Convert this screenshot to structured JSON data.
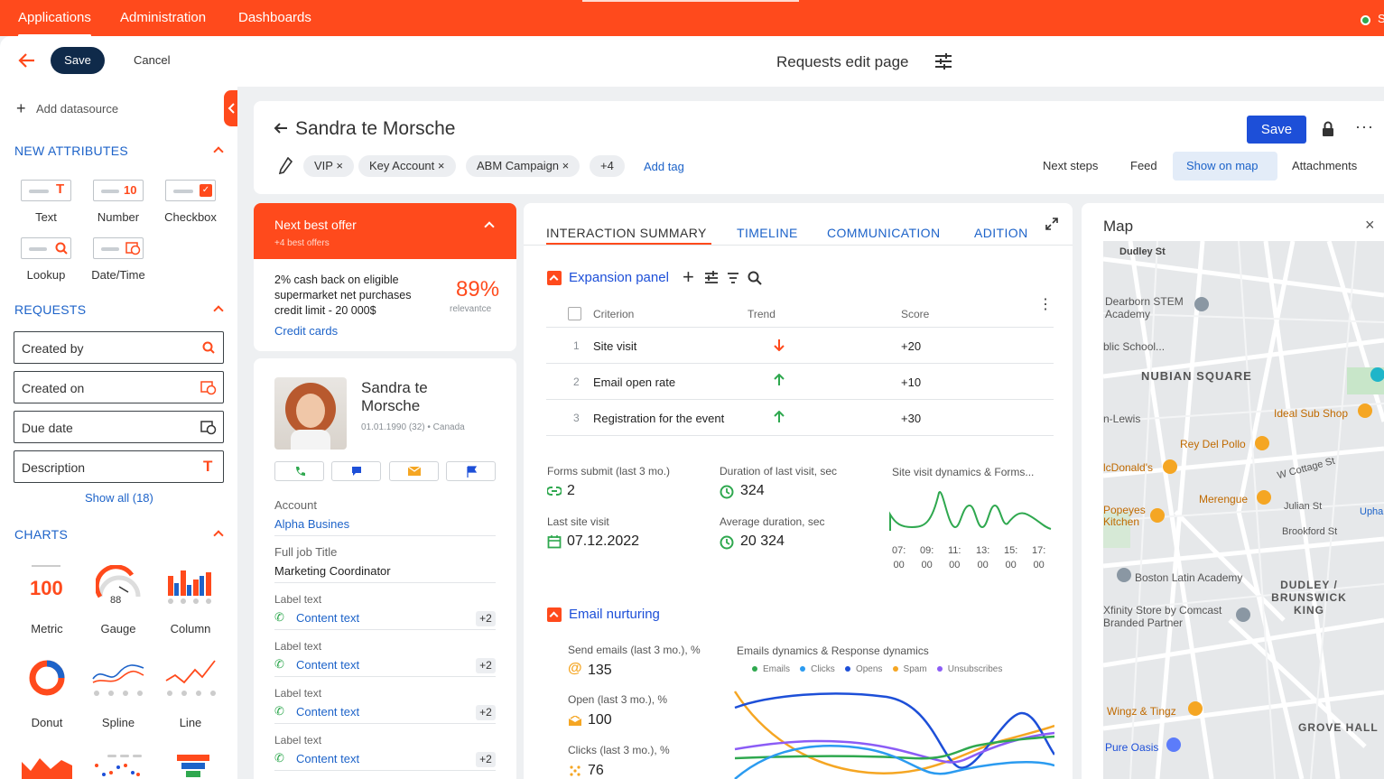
{
  "topnav": {
    "items": [
      "Applications",
      "Administration",
      "Dashboards"
    ],
    "status_text": "S"
  },
  "toolbar": {
    "save_label": "Save",
    "cancel_label": "Cancel",
    "page_title": "Requests edit page"
  },
  "left": {
    "add_datasource": "Add datasource",
    "new_attributes": {
      "title": "NEW ATTRIBUTES",
      "items": [
        "Text",
        "Number",
        "Checkbox",
        "Lookup",
        "Date/Time"
      ],
      "number_value": "10"
    },
    "requests": {
      "title": "REQUESTS",
      "fields": [
        "Created by",
        "Created on",
        "Due date",
        "Description"
      ],
      "show_all": "Show all (18)"
    },
    "charts": {
      "title": "CHARTS",
      "items": [
        "Metric",
        "Gauge",
        "Column",
        "Donut",
        "Spline",
        "Line"
      ],
      "metric_value": "100",
      "gauge_value": "88"
    }
  },
  "record": {
    "name": "Sandra te Morsche",
    "save_label": "Save",
    "tags": [
      "VIP",
      "Key Account",
      "ABM Campaign"
    ],
    "more_tags": "+4",
    "add_tag": "Add tag",
    "actions": [
      "Next steps",
      "Feed",
      "Show on map",
      "Attachments"
    ]
  },
  "offer": {
    "title": "Next best offer",
    "subtitle": "+4 best offers",
    "text": "2% cash back on eligible supermarket net purchases credit limit - 20 000$",
    "percent": "89%",
    "percent_label": "relevantce",
    "link": "Credit cards"
  },
  "contact": {
    "name": "Sandra te Morsche",
    "meta": "01.01.1990 (32) • Canada",
    "account_label": "Account",
    "account_value": "Alpha Busines",
    "job_label": "Full job Title",
    "job_value": "Marketing Coordinator",
    "labels": [
      {
        "label": "Label text",
        "value": "Content text",
        "badge": "+2"
      },
      {
        "label": "Label text",
        "value": "Content text",
        "badge": "+2"
      },
      {
        "label": "Label text",
        "value": "Content text",
        "badge": "+2"
      },
      {
        "label": "Label text",
        "value": "Content text",
        "badge": "+2"
      }
    ]
  },
  "tabs": [
    "INTERACTION SUMMARY",
    "TIMELINE",
    "COMMUNICATION",
    "ADITION"
  ],
  "expansion": {
    "title": "Expansion panel",
    "headers": [
      "Criterion",
      "Trend",
      "Score"
    ],
    "rows": [
      {
        "n": "1",
        "criterion": "Site visit",
        "trend": "down",
        "score": "+20"
      },
      {
        "n": "2",
        "criterion": "Email open rate",
        "trend": "up",
        "score": "+10"
      },
      {
        "n": "3",
        "criterion": "Registration for the event",
        "trend": "up",
        "score": "+30"
      }
    ]
  },
  "metrics": {
    "forms_label": "Forms submit (last 3 mo.)",
    "forms_value": "2",
    "duration_label": "Duration of last visit, sec",
    "duration_value": "324",
    "last_visit_label": "Last site visit",
    "last_visit_value": "07.12.2022",
    "avg_label": "Average duration, sec",
    "avg_value": "20 324",
    "site_chart_title": "Site visit dynamics & Forms...",
    "site_chart_ticks": [
      [
        "07:",
        "00"
      ],
      [
        "09:",
        "00"
      ],
      [
        "11:",
        "00"
      ],
      [
        "13:",
        "00"
      ],
      [
        "15:",
        "00"
      ],
      [
        "17:",
        "00"
      ]
    ]
  },
  "email": {
    "title": "Email nurturing",
    "send_label": "Send emails (last 3 mo.), %",
    "send_value": "135",
    "open_label": "Open (last 3 mo.), %",
    "open_value": "100",
    "clicks_label": "Clicks (last 3 mo.), %",
    "clicks_value": "76",
    "chart_title": "Emails dynamics & Response dynamics",
    "legend": [
      "Emails",
      "Clicks",
      "Opens",
      "Spam",
      "Unsubscribes"
    ],
    "colors": [
      "#2fa84f",
      "#2b9bf0",
      "#1d4fd8",
      "#f5a623",
      "#8b5cf6"
    ]
  },
  "map": {
    "title": "Map",
    "labels": [
      "Dudley St",
      "Dearborn STEM Academy",
      "NUBIAN SQUARE",
      "Ideal Sub Shop",
      "Rey Del Pollo",
      "lcDonald's",
      "W Cottage St",
      "Merengue",
      "Julian St",
      "Popeyes Kitchen",
      "Brookford St",
      "Boston Latin Academy",
      "DUDLEY / BRUNSWICK KING",
      "Xfinity Store by Comcast Branded Partner",
      "Wingz & Tingz",
      "GROVE HALL",
      "Pure Oasis",
      "blic School...",
      "n-Lewis",
      "Upha"
    ]
  }
}
